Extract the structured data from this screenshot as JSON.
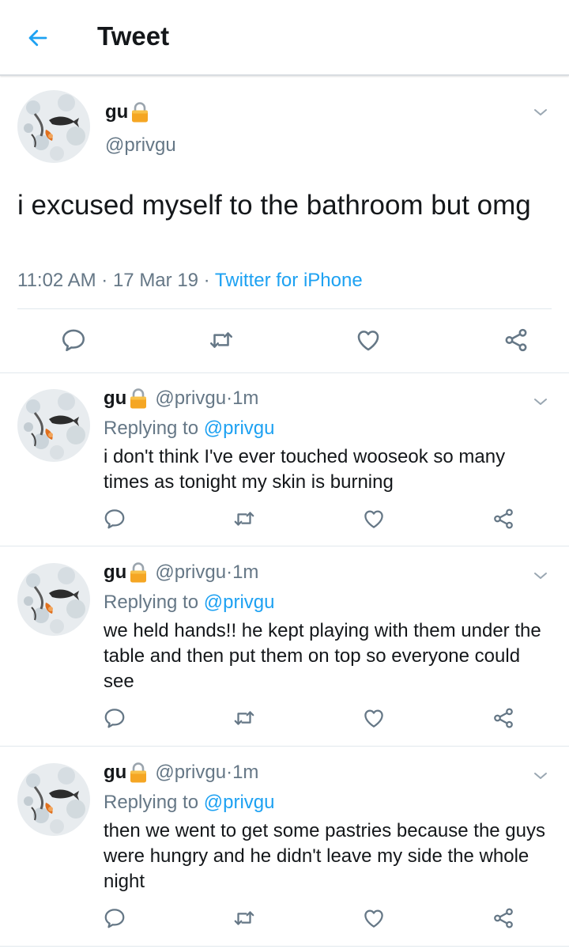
{
  "header": {
    "title": "Tweet",
    "back_icon": "back-arrow-icon"
  },
  "colors": {
    "accent": "#1da1f2",
    "secondary_text": "#657786",
    "lock": "#f5a623"
  },
  "main_tweet": {
    "name": "gu",
    "handle": "@privgu",
    "text": "i excused myself to the bathroom but omg",
    "time": "11:02 AM",
    "date": "17 Mar 19",
    "source": "Twitter for iPhone",
    "separator": " · "
  },
  "replies": [
    {
      "name": "gu",
      "handle": "@privgu",
      "age": "1m",
      "replying_prefix": "Replying to",
      "replying_to": "@privgu",
      "text": "i don't think I've ever touched wooseok so many times as tonight my skin is burning"
    },
    {
      "name": "gu",
      "handle": "@privgu",
      "age": "1m",
      "replying_prefix": "Replying to",
      "replying_to": "@privgu",
      "text": "we held hands!! he kept playing with them under the table and then put them on top so everyone could see"
    },
    {
      "name": "gu",
      "handle": "@privgu",
      "age": "1m",
      "replying_prefix": "Replying to",
      "replying_to": "@privgu",
      "text": "then we went to get some pastries because the guys were hungry and he didn't leave my side the whole night"
    }
  ],
  "icons": [
    "back-arrow-icon",
    "chevron-down-icon",
    "lock-icon",
    "reply-icon",
    "retweet-icon",
    "like-icon",
    "share-icon"
  ]
}
